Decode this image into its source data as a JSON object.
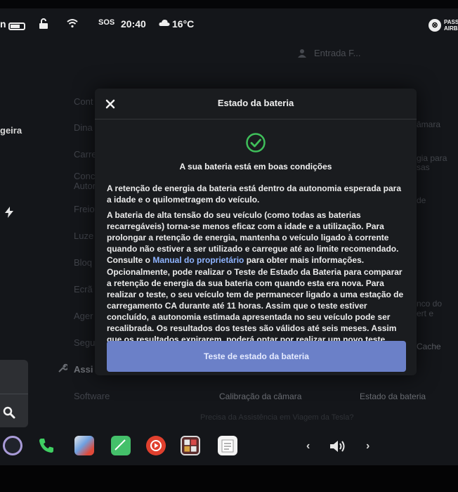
{
  "status_bar": {
    "battery_text": "n",
    "clock": "20:40",
    "temperature": "16°C",
    "sos_label": "SOS",
    "airbag_label": "PASSE AIRBA"
  },
  "background": {
    "profile": "Entrada F...",
    "left_labels": [
      "geira"
    ],
    "menu_items": [
      "Cont",
      "Dina",
      "Carre",
      "Conc Autor",
      "Freio",
      "Luze",
      "Bloq",
      "Ecrã",
      "Ager",
      "Segu",
      "Assi",
      "Software"
    ],
    "right_items": [
      "âmara",
      "gia para sas",
      "de",
      "nco do",
      "ert e",
      "Cache"
    ],
    "under_modal_left": "Calibração da câmara",
    "under_modal_right": "Estado da bateria",
    "faded_question": "Precisa da Assistência em Viagem da Tesla?"
  },
  "modal": {
    "title": "Estado da bateria",
    "status": "A sua bateria está em boas condições",
    "para1": "A retenção de energia da bateria está dentro da autonomia esperada para a idade e o quilometragem do veículo.",
    "para2_start": "A bateria de alta tensão do seu veículo (como todas as baterias recarregáveis) torna-se menos eficaz com a idade e a utilização. Para prolongar a retenção de energia, mantenha o veículo ligado à corrente quando não estiver a ser utilizado e carregue até ao limite recomendado. Consulte o ",
    "para2_link": "Manual do proprietário",
    "para2_end": " para obter mais informações.",
    "para3": "Opcionalmente, pode realizar o Teste de Estado da Bateria para comparar a retenção de energia da sua bateria com quando esta era nova. Para realizar o teste, o seu veículo tem de permanecer ligado a uma estação de carregamento CA durante até 11 horas. Assim que o teste estiver concluído, a autonomia estimada apresentada no seu veículo pode ser recalibrada. Os resultados dos testes são válidos até seis meses. Assim que os resultados expirarem, poderá optar por realizar um novo teste.",
    "button_label": "Teste de estado da bateria"
  },
  "dock": {
    "chevron_left": "‹",
    "chevron_right": "›"
  },
  "colors": {
    "accent_button": "#6b80c8",
    "check_green": "#3fbf5a",
    "link": "#8fb4ff"
  },
  "icons": [
    "battery-icon",
    "lock-icon",
    "wifi-icon",
    "cloud-icon",
    "airbag-icon",
    "close-icon",
    "check-circle-icon",
    "search-icon",
    "camera-app-icon",
    "phone-icon",
    "navigation-icon",
    "notes-icon",
    "media-player-icon",
    "games-icon",
    "calendar-icon",
    "volume-icon"
  ]
}
